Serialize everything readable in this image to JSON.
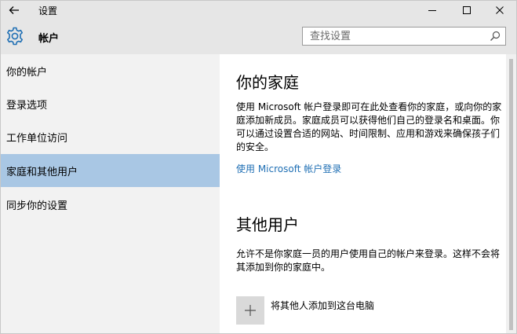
{
  "window": {
    "title": "设置"
  },
  "header": {
    "section_title": "帐户",
    "search_placeholder": "查找设置"
  },
  "sidebar": {
    "items": [
      {
        "label": "你的帐户"
      },
      {
        "label": "登录选项"
      },
      {
        "label": "工作单位访问"
      },
      {
        "label": "家庭和其他用户",
        "active": true
      },
      {
        "label": "同步你的设置"
      }
    ]
  },
  "family": {
    "heading": "你的家庭",
    "description": "使用 Microsoft 帐户登录即可在此处查看你的家庭，或向你的家庭添加新成员。家庭成员可以获得他们自己的登录名和桌面。你可以通过设置合适的网站、时间限制、应用和游戏来确保孩子们的安全。",
    "link": "使用 Microsoft 帐户登录"
  },
  "other_users": {
    "heading": "其他用户",
    "description": "允许不是你家庭一员的用户使用自己的帐户来登录。这样不会将其添加到你的家庭中。",
    "add_label": "将其他人添加到这台电脑"
  },
  "colors": {
    "chrome": "#e6e6e6",
    "sidebar_bg": "#f2f2f2",
    "active_item": "#a9c7e4",
    "link": "#1f6fb4",
    "gear_icon": "#1f6fb4"
  },
  "icons": {
    "back": "arrow-left-icon",
    "minimize": "minimize-icon",
    "maximize": "maximize-icon",
    "close": "close-icon",
    "settings": "gear-icon",
    "search": "search-icon",
    "add": "plus-icon"
  }
}
